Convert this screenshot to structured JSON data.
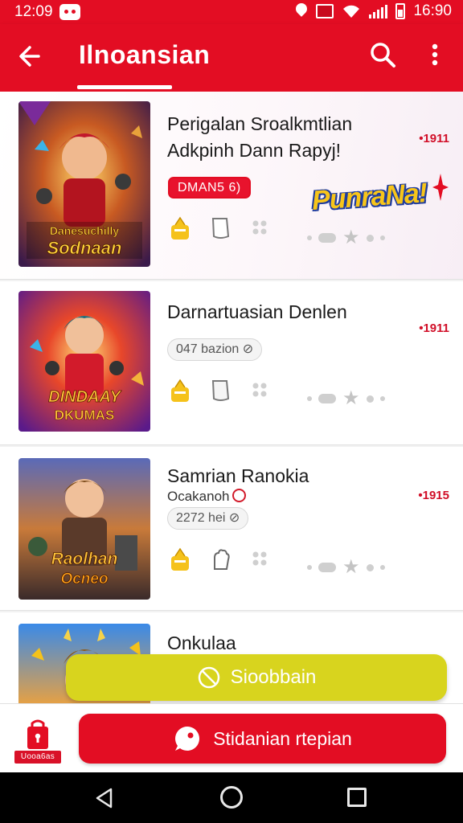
{
  "status_bar": {
    "time": "12:09",
    "right_time": "16:90"
  },
  "app_bar": {
    "title": "Ilnoansian"
  },
  "cards": [
    {
      "title_line1": "Perigalan Sroalkmtlian",
      "title_line2": "Adkpinh Dann Rapyj!",
      "number": "•1911",
      "badge": "DMAN5 6)",
      "promo": "PunraNa!",
      "thumb_text_top": "Danesuchilly",
      "thumb_text_bottom": "Sodnaan"
    },
    {
      "title_line1": "Darnartuasian Denlen",
      "number": "•1911",
      "pill": "047 bazion ⊘",
      "thumb_text_top": "DINDAAY",
      "thumb_text_bottom": "DKUMAS"
    },
    {
      "title_line1": "Samrian Ranokia",
      "subtitle": "Ocakanoh",
      "number": "•1915",
      "pill": "2272 hei ⊘",
      "thumb_text_top": "Raolhan",
      "thumb_text_bottom": "Ocneo"
    },
    {
      "title_line1": "Onkulaa"
    }
  ],
  "floating_button": {
    "label": "Sioobbain"
  },
  "bottom_bar": {
    "bag_label": "Uooa6as",
    "action_label": "Stidanian rtepian"
  },
  "colors": {
    "primary": "#e30d23",
    "accent_yellow": "#d8d41e",
    "promo_yellow": "#f7c51a"
  }
}
